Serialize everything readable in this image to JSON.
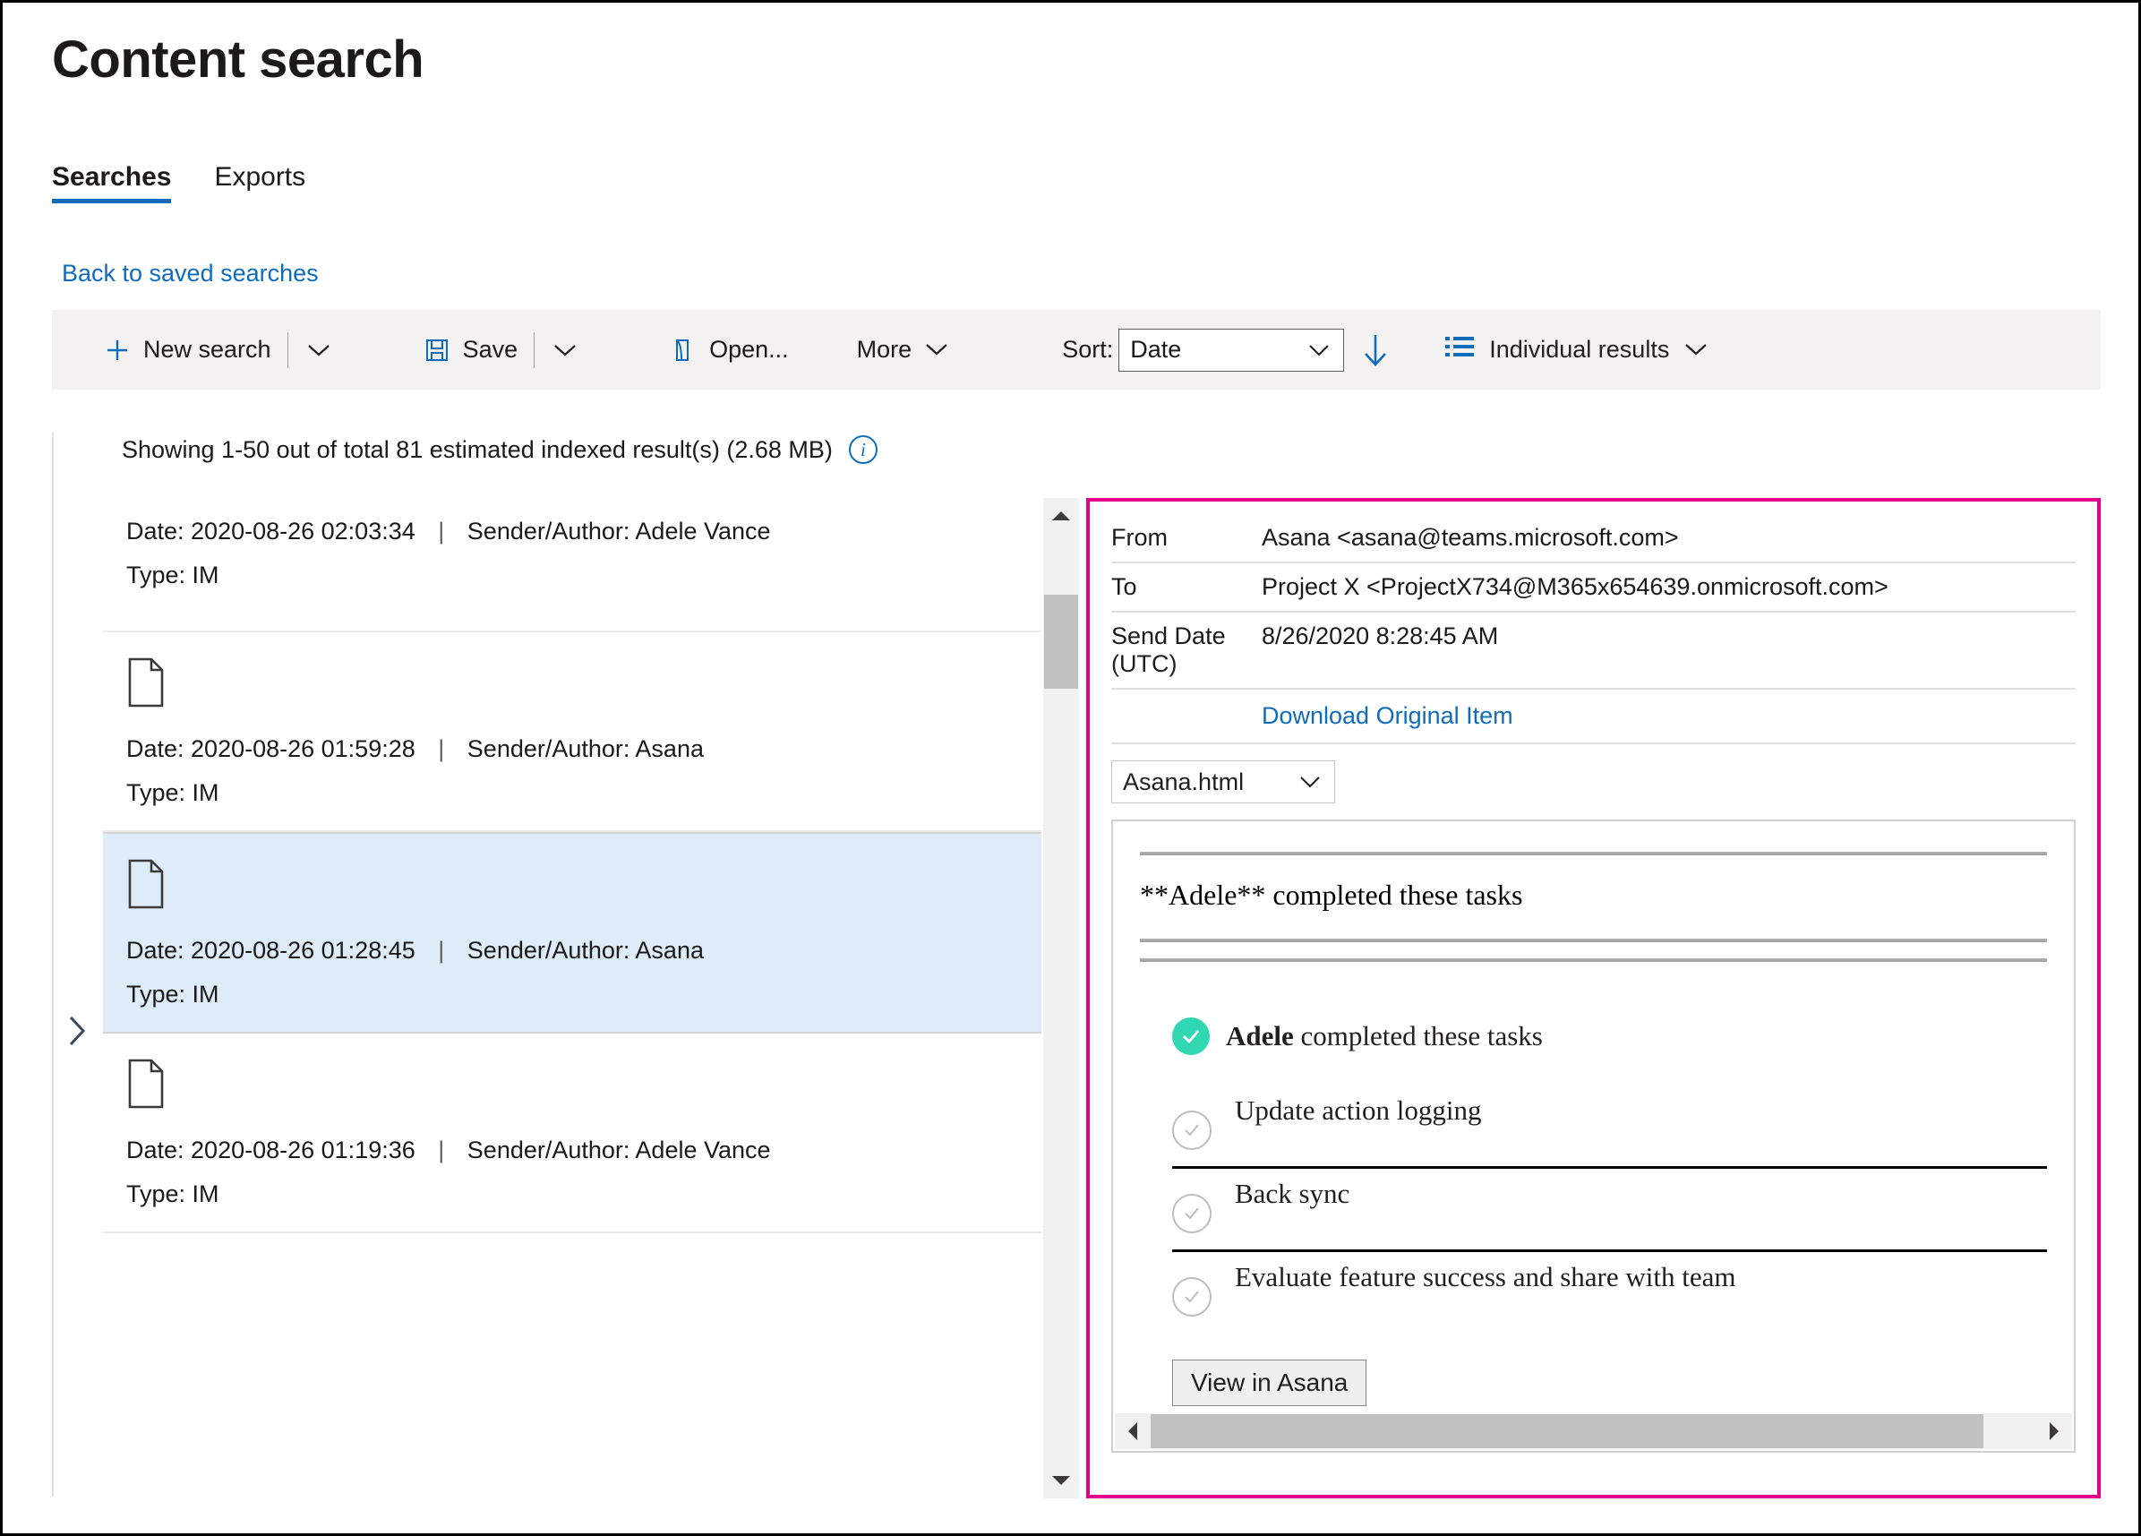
{
  "page": {
    "title": "Content search"
  },
  "tabs": [
    {
      "label": "Searches",
      "selected": true
    },
    {
      "label": "Exports",
      "selected": false
    }
  ],
  "back_link": "Back to saved searches",
  "toolbar": {
    "new_search": "New search",
    "save": "Save",
    "open": "Open...",
    "more": "More",
    "sort_label": "Sort:",
    "sort_value": "Date",
    "sort_direction": "descending",
    "results_view": "Individual results",
    "icons": {
      "new_search": "plus-icon",
      "save": "floppy-disk-icon",
      "open": "open-folder-icon",
      "caret": "chevron-down-icon",
      "sort_dir": "arrow-down-icon",
      "results_view": "list-icon"
    },
    "accent_color": "#0f6cbd"
  },
  "results": {
    "summary": "Showing 1-50 out of total 81 estimated indexed result(s) (2.68 MB)",
    "info_glyph": "i",
    "items": [
      {
        "has_icon": false,
        "date": "Date: 2020-08-26 02:03:34",
        "separator": "|",
        "author": "Sender/Author: Adele Vance",
        "type": "Type: IM",
        "selected": false
      },
      {
        "has_icon": true,
        "date": "Date: 2020-08-26 01:59:28",
        "separator": "|",
        "author": "Sender/Author: Asana",
        "type": "Type: IM",
        "selected": false
      },
      {
        "has_icon": true,
        "date": "Date: 2020-08-26 01:28:45",
        "separator": "|",
        "author": "Sender/Author: Asana",
        "type": "Type: IM",
        "selected": true
      },
      {
        "has_icon": true,
        "date": "Date: 2020-08-26 01:19:36",
        "separator": "|",
        "author": "Sender/Author: Adele Vance",
        "type": "Type: IM",
        "selected": false
      }
    ]
  },
  "preview": {
    "border_color": "#e3008c",
    "from_label": "From",
    "from_value": "Asana <asana@teams.microsoft.com>",
    "to_label": "To",
    "to_value": "Project X <ProjectX734@M365x654639.onmicrosoft.com>",
    "send_date_label": "Send Date",
    "send_date_value": "8/26/2020 8:28:45 AM",
    "utc_label": "(UTC)",
    "download_link": "Download Original Item",
    "attachment_select": "Asana.html",
    "document": {
      "raw_heading": "**Adele** completed these tasks",
      "card_title_bold": "Adele",
      "card_title_rest": " completed these tasks",
      "check_color": "#2fd8b3",
      "tasks": [
        "Update action logging",
        "Back sync",
        "Evaluate feature success and share with team"
      ],
      "action_button": "View in Asana"
    }
  }
}
